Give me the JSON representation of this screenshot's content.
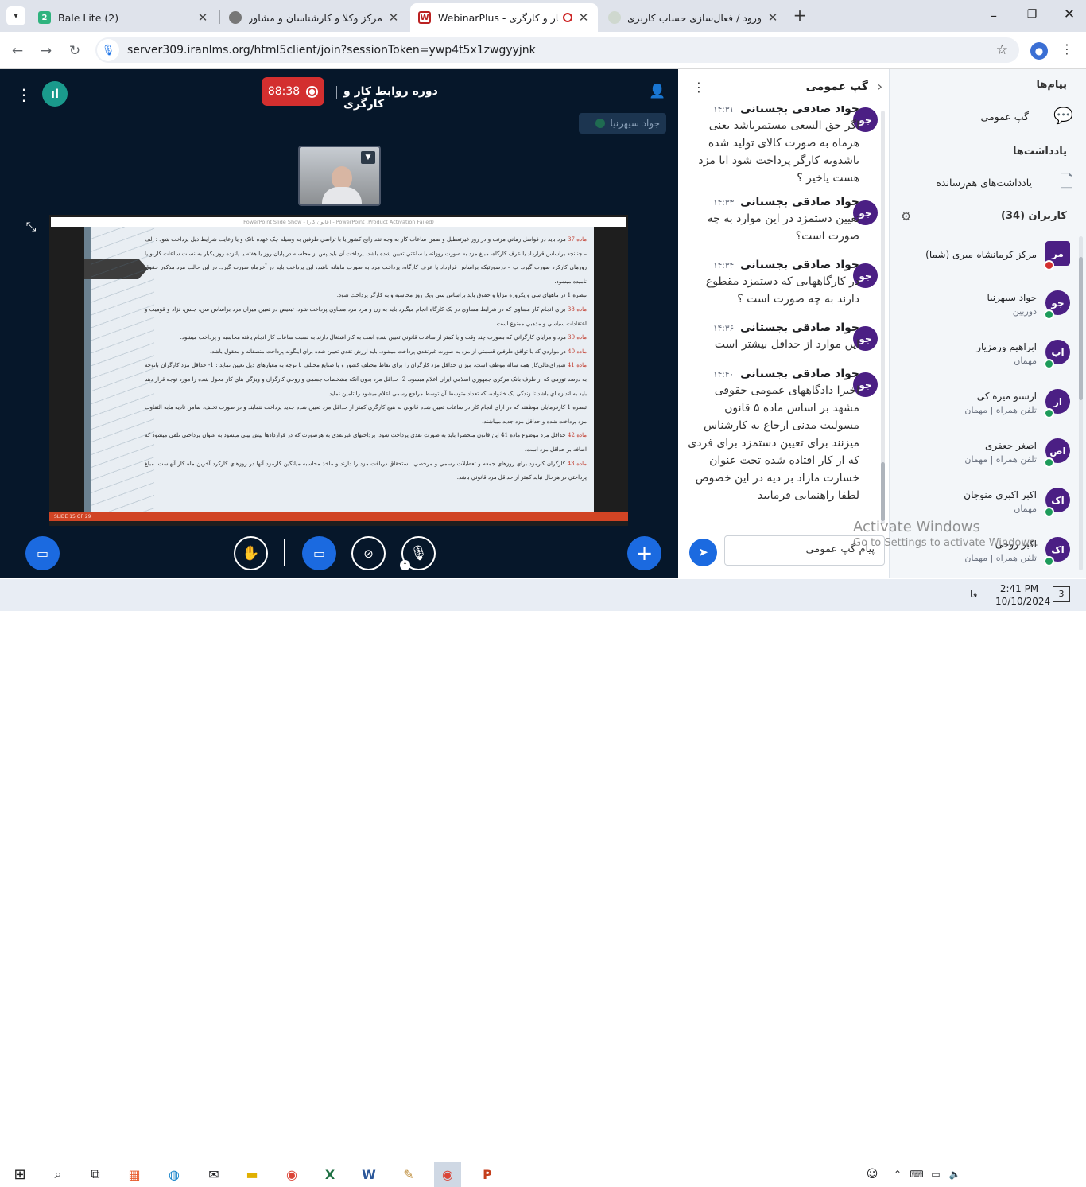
{
  "browser": {
    "tabs": [
      {
        "title": "Bale Lite (2)",
        "icon": "bale-icon",
        "active": false
      },
      {
        "title": "مرکز وکلا و کارشناسان و مشاوران",
        "icon": "globe-icon",
        "active": false
      },
      {
        "title": "WebinarPlus - کار و کارگری",
        "icon": "webinar-icon",
        "active": true
      },
      {
        "title": "ورود / فعال‌سازی حساب کاربری -",
        "icon": "site-icon",
        "active": false
      }
    ],
    "url": "server309.iranlms.org/html5client/join?sessionToken=ywp4t5x1zwgyyjnk",
    "new_tab_label": "+"
  },
  "meeting": {
    "title": "دوره روابط کار و کارگری",
    "timer": "88:38",
    "presenter_name": "جواد سیهرنیا",
    "slide_footer": "SLIDE 15 OF 29",
    "slide_titlebar": "PowerPoint Slide Show - [قانون کار] - PowerPoint (Product Activation Failed)",
    "slide_lines": [
      {
        "label": "ماده 37",
        "text": "مزد بايد در فواصل زماني مرتب و در روز غيرتعطيل و ضمن ساعات کار به وجه نقد رايج کشور يا با تراضي طرفين به وسيله چک عهده بانک و يا رعايت شرايط ذيل پرداخت شود : الف – چنانچه براساس قرارداد يا عرف کارگاه، مبلغ مزد به صورت روزانه يا ساعتي تعيين شده باشد، پرداخت آن بايد پس از محاسبه در پايان روز يا هفته يا پانزده روز يکبار به نسبت ساعات کار و يا روزهاي کارکرد صورت گيرد. ب – درصورتيکه براساس قرارداد يا عرف کارگاه، پرداخت مزد به صورت ماهانه باشد، اين پرداخت بايد در آخرماه صورت گيرد. در اين حالت مزد مذکور حقوق ناميده ميشود."
      },
      {
        "label": "",
        "text": "تبصره 1 در ماههاي سي و يکروزه مزايا و حقوق بايد براساس سي ويک روز محاسبه و به کارگر پرداخت شود."
      },
      {
        "label": "ماده 38",
        "text": "براي انجام کار مساوي که در شرايط مساوي در يک کارگاه انجام ميگيرد بايد به زن و مرد مزد مساوي پرداخت شود. تبعيض در تعيين ميزان مزد براساس سن، جنس، نژاد و قوميت و اعتقادات سياسي و مذهبي ممنوع است."
      },
      {
        "label": "ماده 39",
        "text": "مزد و مزاياي کارگراني که بصورت چند وقت و يا کمتر از ساعات قانوني تعيين شده است به کار اشتغال دارند به نسبت ساعات کار انجام يافته محاسبه و پرداخت ميشود."
      },
      {
        "label": "ماده 40",
        "text": "در مواردي که با توافق طرفين قسمتي از مزد به صورت غيرنقدي پرداخت ميشود، بايد ارزش نقدي تعيين شده براي اينگونه پرداخت منصفانه و معقول باشد."
      },
      {
        "label": "ماده 41",
        "text": "شوراي‌عالي‌کار همه ساله موظف است، ميزان حداقل مزد کارگران را براي نقاط مختلف کشور و يا صنايع مختلف با توجه به معيارهاي ذيل تعيين نمايد : 1- حداقل مزد کارگران باتوجه به درصد تورمي که از طرف بانک مرکزي جمهوري اسلامي ايران اعلام ميشود. 2- حداقل مزد بدون آنکه مشخصات جسمي و روحي کارگران و ويژگي هاي کار محول شده را مورد توجه قرار دهد بايد به اندازه اي باشد تا زندگي يک خانواده، که تعداد متوسط آن توسط مراجع رسمي اعلام ميشود را تامين نمايد."
      },
      {
        "label": "",
        "text": "تبصره 1 کارفرمايان موظفند که در ازاي انجام کار در ساعات تعيين شده قانوني به هيچ کارگري کمتر از حداقل مزد تعيين شده جديد پرداخت ننمايند و در صورت تخلف، ضامن تاديه مابه التفاوت مزد پرداخت شده و حداقل مزد جديد ميباشند."
      },
      {
        "label": "ماده 42",
        "text": "حداقل مزد موضوع ماده 41 اين قانون منحصرا بايد به صورت نقدي پرداخت شود. پرداختهاي غيرنقدي به هرصورت که در قراردادها پيش بيني ميشود به عنوان پرداختي تلقي ميشود که اضافه بر حداقل مزد است."
      },
      {
        "label": "ماده 43",
        "text": "کارگران کارمزد براي روزهاي جمعه و تعطيلات رسمي و مرخصي، استحقاق دريافت مزد را دارند و ماخذ محاسبه ميانگين کارمزد آنها در روزهاي کارکرد آخرين ماه کار آنهاست. مبلغ پرداختي در هرحال نبايد کمتر از حداقل مزد قانوني باشد."
      }
    ]
  },
  "chat": {
    "title": "گپ عمومی",
    "messages": [
      {
        "avatar": "جو",
        "name": "جواد صادقی بجستانی",
        "time": "۱۴:۳۱",
        "text": "اگر حق السعی مستمرباشد یعنی هرماه به صورت کالای تولید شده باشدوبه کارگر پرداخت شود ایا مزد هست یاخیر ؟"
      },
      {
        "avatar": "جو",
        "name": "جواد صادقی بجستانی",
        "time": "۱۴:۳۳",
        "text": "تعیین دستمزد در این موارد به چه صورت است؟"
      },
      {
        "avatar": "جو",
        "name": "جواد صادقی بجستانی",
        "time": "۱۴:۳۴",
        "text": "در کارگاههایی که دستمزد مقطوع دارند به چه صورت است ؟"
      },
      {
        "avatar": "جو",
        "name": "جواد صادقی بجستانی",
        "time": "۱۴:۳۶",
        "text": "این موارد از حداقل بیشتر است"
      },
      {
        "avatar": "جو",
        "name": "جواد صادقی بجستانی",
        "time": "۱۴:۴۰",
        "text": "اخیرا دادگاههای عمومی حقوقی مشهد بر اساس ماده ۵ قانون مسولیت مدنی ارجاع به کارشناس میزنند برای تعیین دستمزد برای فردی که از کار افتاده شده تحت عنوان خسارت مازاد بر دیه در این خصوص لطفا راهنمایی فرمایید"
      }
    ],
    "input_placeholder": "پیام گپ عمومی"
  },
  "sidebar": {
    "messages_heading": "پیام‌ها",
    "public_chat": "گپ عمومی",
    "notes_heading": "یادداشت‌ها",
    "shared_notes": "یادداشت‌های هم‌رسانده",
    "users_heading": "کاربران (34)",
    "users": [
      {
        "initials": "مر",
        "name": "مرکز کرمانشاه-میری (شما)",
        "role": "",
        "color": "#4b1f84"
      },
      {
        "initials": "جو",
        "name": "جواد سیهرنیا",
        "role": "دوربین",
        "color": "#4b1f84"
      },
      {
        "initials": "اب",
        "name": "ابراهیم ورمزیار",
        "role": "مهمان",
        "color": "#4b1f84"
      },
      {
        "initials": "ار",
        "name": "ارستو میره کی",
        "role": "تلفن همراه | مهمان",
        "color": "#4b1f84"
      },
      {
        "initials": "اص",
        "name": "اصغر جعفری",
        "role": "تلفن همراه | مهمان",
        "color": "#4b1f84"
      },
      {
        "initials": "اک",
        "name": "اکبر اکبری منوجان",
        "role": "مهمان",
        "color": "#4b1f84"
      },
      {
        "initials": "اک",
        "name": "اکبر روحی",
        "role": "تلفن همراه | مهمان",
        "color": "#4b1f84"
      }
    ]
  },
  "watermark": {
    "line1": "Activate Windows",
    "line2": "Go to Settings to activate Windows."
  },
  "taskbar": {
    "time": "2:41 PM",
    "date": "10/10/2024",
    "lang": "فا",
    "notifications": "3"
  },
  "colors": {
    "app_bg": "#06172a",
    "accent": "#1b6ae0",
    "record": "#d32f2f",
    "avatar": "#4b1f84"
  }
}
